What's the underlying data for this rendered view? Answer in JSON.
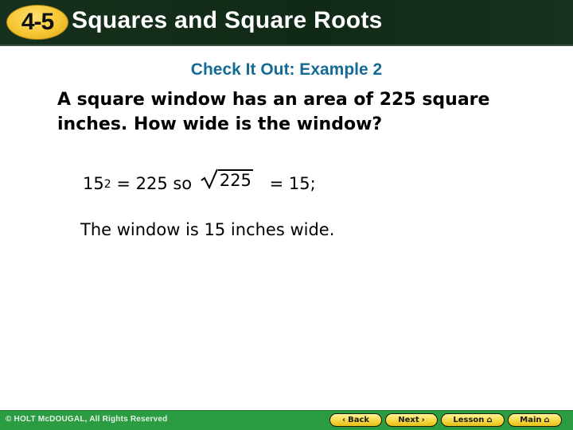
{
  "header": {
    "lesson_number": "4-5",
    "title": "Squares and Square Roots"
  },
  "content": {
    "subtitle": "Check It Out: Example 2",
    "problem": "A square window has an area of 225 square inches. How wide is the window?",
    "equation": {
      "base": "15",
      "exponent": "2",
      "middle": " = 225 so ",
      "radicand": "225",
      "result": " = 15;"
    },
    "answer": "The window is 15 inches wide."
  },
  "footer": {
    "copyright": "© HOLT McDOUGAL, All Rights Reserved",
    "nav": {
      "back_label": "Back",
      "next_label": "Next",
      "lesson_label": "Lesson",
      "main_label": "Main",
      "back_icon": "‹",
      "next_icon": "›",
      "home_icon": "⌂"
    }
  },
  "colors": {
    "header_bg": "#15301c",
    "badge": "#f6c632",
    "subtitle": "#156a96",
    "footer_bg": "#2b9c42",
    "nav_button": "#f5d63b"
  }
}
